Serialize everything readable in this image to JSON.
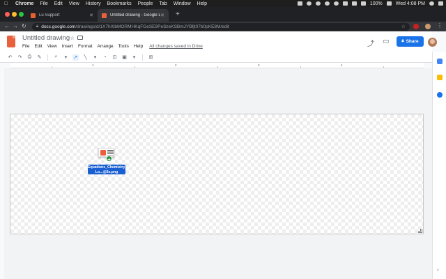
{
  "mac_menubar": {
    "app_name": "Chrome",
    "items": [
      "File",
      "Edit",
      "View",
      "History",
      "Bookmarks",
      "People",
      "Tab",
      "Window",
      "Help"
    ],
    "battery": "100%",
    "clock": "Wed 4:08 PM"
  },
  "browser": {
    "tabs": [
      {
        "title": "Lu Support",
        "active": false
      },
      {
        "title": "Untitled drawing - Google Dra",
        "active": true
      }
    ],
    "url_host": "docs.google.com",
    "url_path": "/drawings/d/1X7hXlbMORMHKqFGeSE9PeSzeKSBmJYBfjt07b0pKE8M/edit"
  },
  "app": {
    "title": "Untitled drawing",
    "menus": [
      "File",
      "Edit",
      "View",
      "Insert",
      "Format",
      "Arrange",
      "Tools",
      "Help"
    ],
    "save_status": "All changes saved in Drive",
    "share_label": "Share"
  },
  "ruler": {
    "marks": [
      "1",
      "2",
      "3",
      "4"
    ]
  },
  "canvas": {
    "drag_file_label": "Equations_Chemistry_Lt Lo...@2x.png",
    "drag_badge": "+"
  },
  "colors": {
    "share_blue": "#1a73e8",
    "drawings_orange": "#e8603c",
    "drag_label_blue": "#1a5fd1"
  }
}
